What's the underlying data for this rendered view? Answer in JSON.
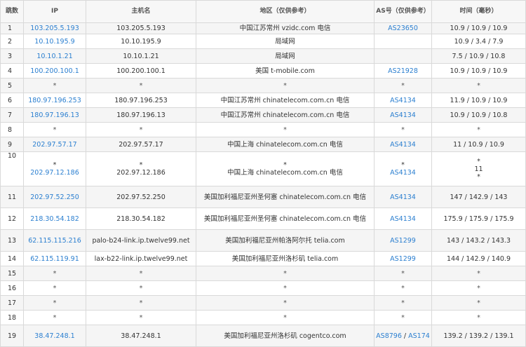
{
  "headers": {
    "hop": "跳数",
    "ip": "IP",
    "host": "主机名",
    "region": "地区（仅供参考）",
    "as": "AS号（仅供参考）",
    "time": "时间（毫秒）"
  },
  "rows": [
    {
      "hop": "1",
      "ip": "103.205.5.193",
      "host": "103.205.5.193",
      "region": "中国江苏常州 vzidc.com 电信",
      "as": [
        "AS23650"
      ],
      "time": "10.9 / 10.9 / 10.9"
    },
    {
      "hop": "2",
      "ip": "10.10.195.9",
      "host": "10.10.195.9",
      "region": "局域网",
      "as": [],
      "time": "10.9 / 3.4 / 7.9"
    },
    {
      "hop": "3",
      "ip": "10.10.1.21",
      "host": "10.10.1.21",
      "region": "局域网",
      "as": [],
      "time": "7.5 / 10.9 / 10.8"
    },
    {
      "hop": "4",
      "ip": "100.200.100.1",
      "host": "100.200.100.1",
      "region": "美国 t-mobile.com",
      "as": [
        "AS21928"
      ],
      "time": "10.9 / 10.9 / 10.9"
    },
    {
      "hop": "5",
      "ip": "*",
      "host": "*",
      "region": "*",
      "as": [
        "*"
      ],
      "time": "*"
    },
    {
      "hop": "6",
      "ip": "180.97.196.253",
      "host": "180.97.196.253",
      "region": "中国江苏常州 chinatelecom.com.cn 电信",
      "as": [
        "AS4134"
      ],
      "time": "11.9 / 10.9 / 10.9"
    },
    {
      "hop": "7",
      "ip": "180.97.196.13",
      "host": "180.97.196.13",
      "region": "中国江苏常州 chinatelecom.com.cn 电信",
      "as": [
        "AS4134"
      ],
      "time": "10.9 / 10.9 / 10.8"
    },
    {
      "hop": "8",
      "ip": "*",
      "host": "*",
      "region": "*",
      "as": [
        "*"
      ],
      "time": "*"
    },
    {
      "hop": "9",
      "ip": "202.97.57.17",
      "host": "202.97.57.17",
      "region": "中国上海 chinatelecom.com.cn 电信",
      "as": [
        "AS4134"
      ],
      "time": "11 / 10.9 / 10.9"
    },
    {
      "hop": "10",
      "ip": "202.97.12.186",
      "host": "202.97.12.186",
      "region": "中国上海 chinatelecom.com.cn 电信",
      "as": [
        "AS4134"
      ],
      "time": "11",
      "star_wrapped": true
    },
    {
      "hop": "11",
      "ip": "202.97.52.250",
      "host": "202.97.52.250",
      "region": "美国加利福尼亚州圣何塞 chinatelecom.com.cn 电信",
      "as": [
        "AS4134"
      ],
      "time": "147 / 142.9 / 143"
    },
    {
      "hop": "12",
      "ip": "218.30.54.182",
      "host": "218.30.54.182",
      "region": "美国加利福尼亚州圣何塞 chinatelecom.com.cn 电信",
      "as": [
        "AS4134"
      ],
      "time": "175.9 / 175.9 / 175.9"
    },
    {
      "hop": "13",
      "ip": "62.115.115.216",
      "host": "palo-b24-link.ip.twelve99.net",
      "region": "美国加利福尼亚州帕洛阿尔托 telia.com",
      "as": [
        "AS1299"
      ],
      "time": "143 / 143.2 / 143.3"
    },
    {
      "hop": "14",
      "ip": "62.115.119.91",
      "host": "lax-b22-link.ip.twelve99.net",
      "region": "美国加利福尼亚州洛杉矶 telia.com",
      "as": [
        "AS1299"
      ],
      "time": "144 / 142.9 / 140.9"
    },
    {
      "hop": "15",
      "ip": "*",
      "host": "*",
      "region": "*",
      "as": [
        "*"
      ],
      "time": "*"
    },
    {
      "hop": "16",
      "ip": "*",
      "host": "*",
      "region": "*",
      "as": [
        "*"
      ],
      "time": "*"
    },
    {
      "hop": "17",
      "ip": "*",
      "host": "*",
      "region": "*",
      "as": [
        "*"
      ],
      "time": "*"
    },
    {
      "hop": "18",
      "ip": "*",
      "host": "*",
      "region": "*",
      "as": [
        "*"
      ],
      "time": "*"
    },
    {
      "hop": "19",
      "ip": "38.47.248.1",
      "host": "38.47.248.1",
      "region": "美国加利福尼亚州洛杉矶 cogentco.com",
      "as": [
        "AS8796",
        "AS174"
      ],
      "time": "139.2 / 139.2 / 139.1"
    }
  ],
  "colors": {
    "link": "#2b7fd0",
    "border": "#d9d9d9",
    "stripe": "#f5f5f5"
  }
}
